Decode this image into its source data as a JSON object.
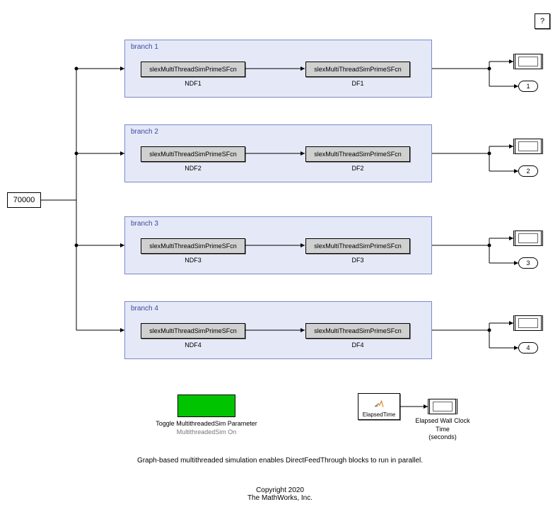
{
  "help_label": "?",
  "constant_value": "70000",
  "branches": [
    {
      "title": "branch 1",
      "sfcn": "slexMultiThreadSimPrimeSFcn",
      "ndf": "NDF1",
      "df": "DF1",
      "outport": "1"
    },
    {
      "title": "branch 2",
      "sfcn": "slexMultiThreadSimPrimeSFcn",
      "ndf": "NDF2",
      "df": "DF2",
      "outport": "2"
    },
    {
      "title": "branch 3",
      "sfcn": "slexMultiThreadSimPrimeSFcn",
      "ndf": "NDF3",
      "df": "DF3",
      "outport": "3"
    },
    {
      "title": "branch 4",
      "sfcn": "slexMultiThreadSimPrimeSFcn",
      "ndf": "NDF4",
      "df": "DF4",
      "outport": "4"
    }
  ],
  "toggle": {
    "label_line1": "Toggle MultithreadedSim Parameter",
    "label_line2": "MultithreadedSim On"
  },
  "elapsed_block_label": "ElapsedTime",
  "clock_label_line1": "Elapsed Wall Clock Time",
  "clock_label_line2": "(seconds)",
  "footer_desc": "Graph-based multithreaded simulation enables DirectFeedThrough blocks to run in parallel.",
  "footer_copyright": "Copyright 2020",
  "footer_company": "The MathWorks, Inc."
}
